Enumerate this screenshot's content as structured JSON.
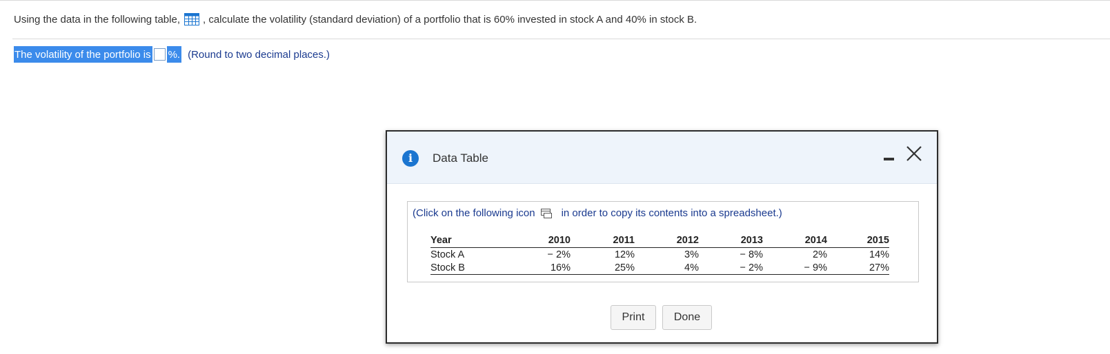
{
  "question": {
    "prefix": "Using the data in the following table,",
    "table_icon": "table-grid-icon",
    "suffix": ", calculate the volatility (standard deviation) of a portfolio that is 60% invested in stock A and 40% in stock B."
  },
  "answer": {
    "label": "The volatility of the portfolio is",
    "value": "",
    "unit": "%.",
    "hint": "(Round to two decimal places.)"
  },
  "dialog": {
    "title": "Data Table",
    "info_icon": "i",
    "copy_prefix": "(Click on the following icon",
    "copy_icon": "copy-spreadsheet-icon",
    "copy_suffix": "in order to copy its contents into a spreadsheet.)",
    "table": {
      "headers": [
        "Year",
        "2010",
        "2011",
        "2012",
        "2013",
        "2014",
        "2015"
      ],
      "rows": [
        [
          "Stock A",
          "− 2%",
          "12%",
          "3%",
          "− 8%",
          "2%",
          "14%"
        ],
        [
          "Stock B",
          "16%",
          "25%",
          "4%",
          "− 2%",
          "− 9%",
          "27%"
        ]
      ]
    },
    "print_label": "Print",
    "done_label": "Done"
  },
  "colors": {
    "highlight": "#3b8beb",
    "info_icon": "#1b75d0",
    "link_text": "#1a3a8f",
    "dialog_header": "#eef4fb"
  }
}
